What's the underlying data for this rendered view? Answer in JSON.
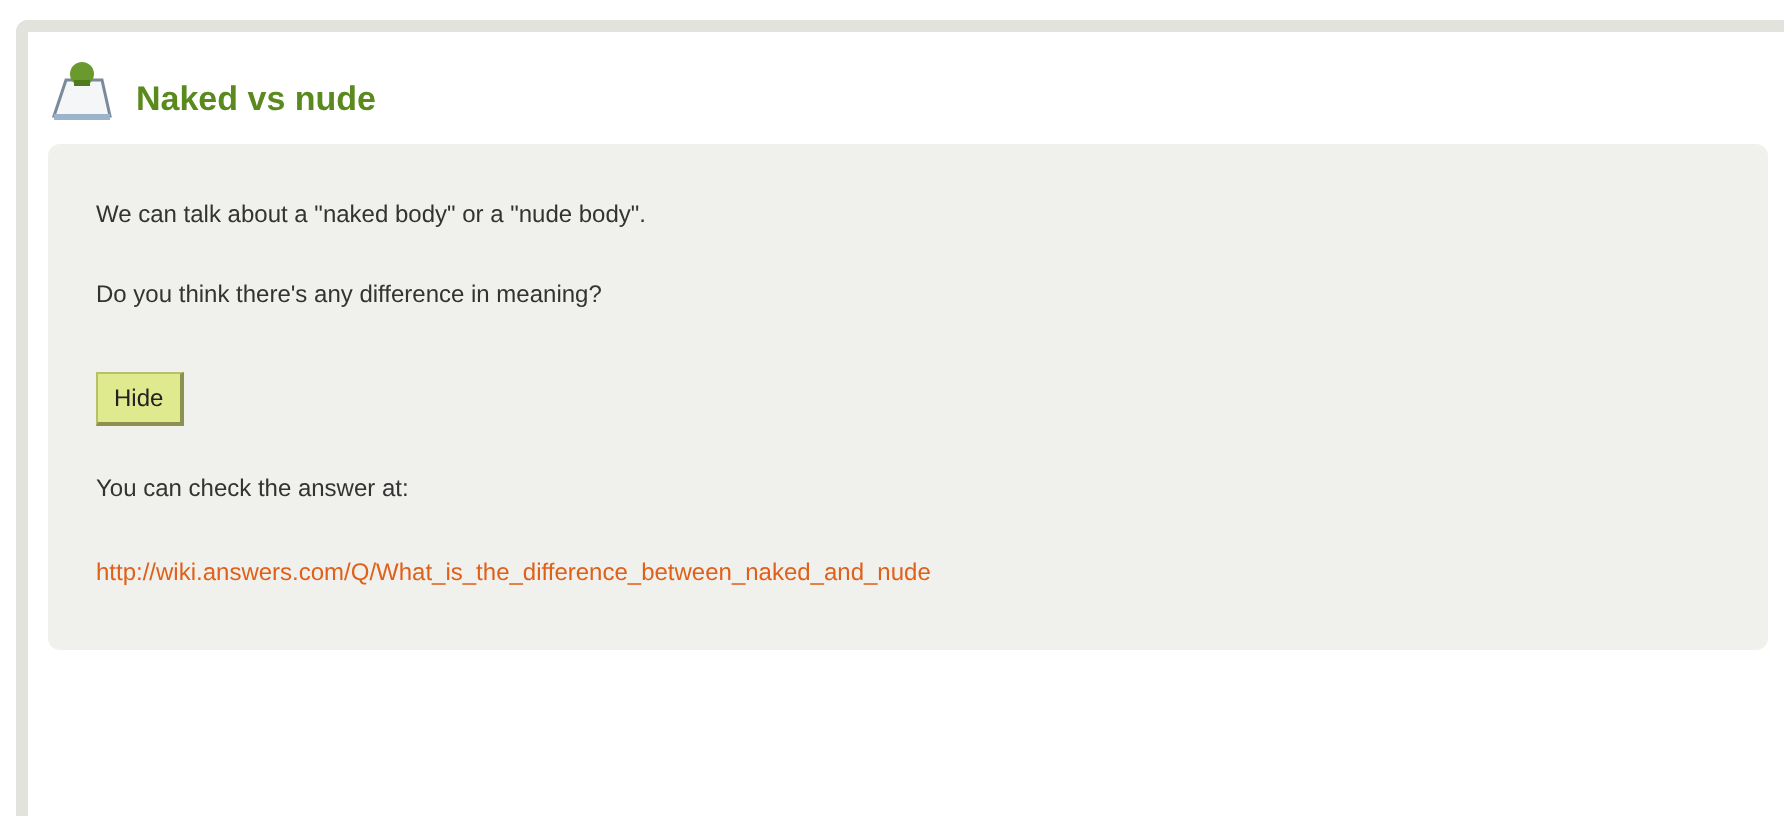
{
  "title": "Naked vs nude",
  "paragraphs": [
    "We can talk about a \"naked body\" or a \"nude body\".",
    "Do you think there's any difference in meaning?"
  ],
  "button": "Hide",
  "answer_intro": "You can check the answer at:",
  "link": "http://wiki.answers.com/Q/What_is_the_difference_between_naked_and_nude"
}
